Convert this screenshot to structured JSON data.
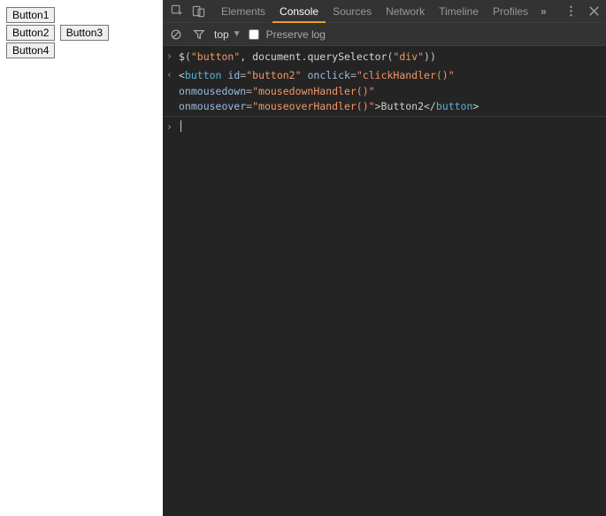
{
  "page": {
    "buttons": [
      "Button1",
      "Button2",
      "Button3",
      "Button4"
    ]
  },
  "tabs": {
    "items": [
      "Elements",
      "Console",
      "Sources",
      "Network",
      "Timeline",
      "Profiles"
    ],
    "active": "Console"
  },
  "toolbar": {
    "context": "top",
    "preserve_label": "Preserve log",
    "preserve_checked": false
  },
  "console": {
    "input_line": {
      "fn": "$",
      "arg1": "\"button\"",
      "sep": ", ",
      "obj": "document",
      "dot": ".",
      "method": "querySelector",
      "arg2": "\"div\""
    },
    "output_node": {
      "open_tag": "button",
      "attrs": [
        {
          "name": "id",
          "value": "\"button2\""
        },
        {
          "name": "onclick",
          "value": "\"clickHandler()\""
        },
        {
          "name": "onmousedown",
          "value": "\"mousedownHandler()\""
        },
        {
          "name": "onmouseover",
          "value": "\"mouseoverHandler()\""
        }
      ],
      "text": "Button2",
      "close_tag": "button"
    }
  }
}
